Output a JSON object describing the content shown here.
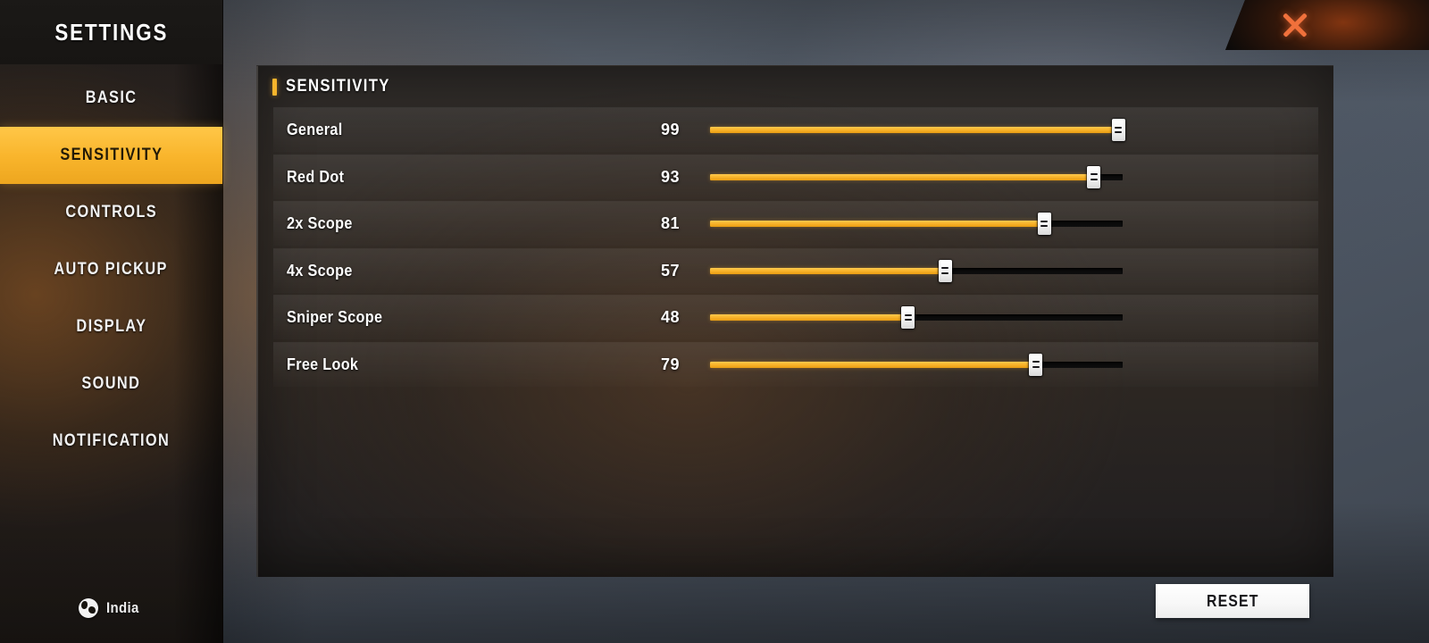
{
  "window": {
    "title": "SETTINGS",
    "close_icon": "close-x-icon"
  },
  "sidebar": {
    "items": [
      {
        "label": "BASIC",
        "active": false
      },
      {
        "label": "SENSITIVITY",
        "active": true
      },
      {
        "label": "CONTROLS",
        "active": false
      },
      {
        "label": "AUTO PICKUP",
        "active": false
      },
      {
        "label": "DISPLAY",
        "active": false
      },
      {
        "label": "SOUND",
        "active": false
      },
      {
        "label": "NOTIFICATION",
        "active": false
      }
    ],
    "region": {
      "icon": "globe-icon",
      "label": "India"
    }
  },
  "panel": {
    "title": "SENSITIVITY",
    "accent_color": "#f7b52c",
    "slider_min": 0,
    "slider_max": 100,
    "rows": [
      {
        "label": "General",
        "value": 99
      },
      {
        "label": "Red Dot",
        "value": 93
      },
      {
        "label": "2x Scope",
        "value": 81
      },
      {
        "label": "4x Scope",
        "value": 57
      },
      {
        "label": "Sniper Scope",
        "value": 48
      },
      {
        "label": "Free Look",
        "value": 79
      }
    ]
  },
  "footer": {
    "reset_label": "RESET"
  },
  "colors": {
    "accent": "#f7b52c",
    "slider_fill": "#f9b52c",
    "slider_track": "#0a0a0a",
    "handle": "#ffffff",
    "close_x": "#f0713c",
    "sidebar_active_text": "#231a07"
  }
}
